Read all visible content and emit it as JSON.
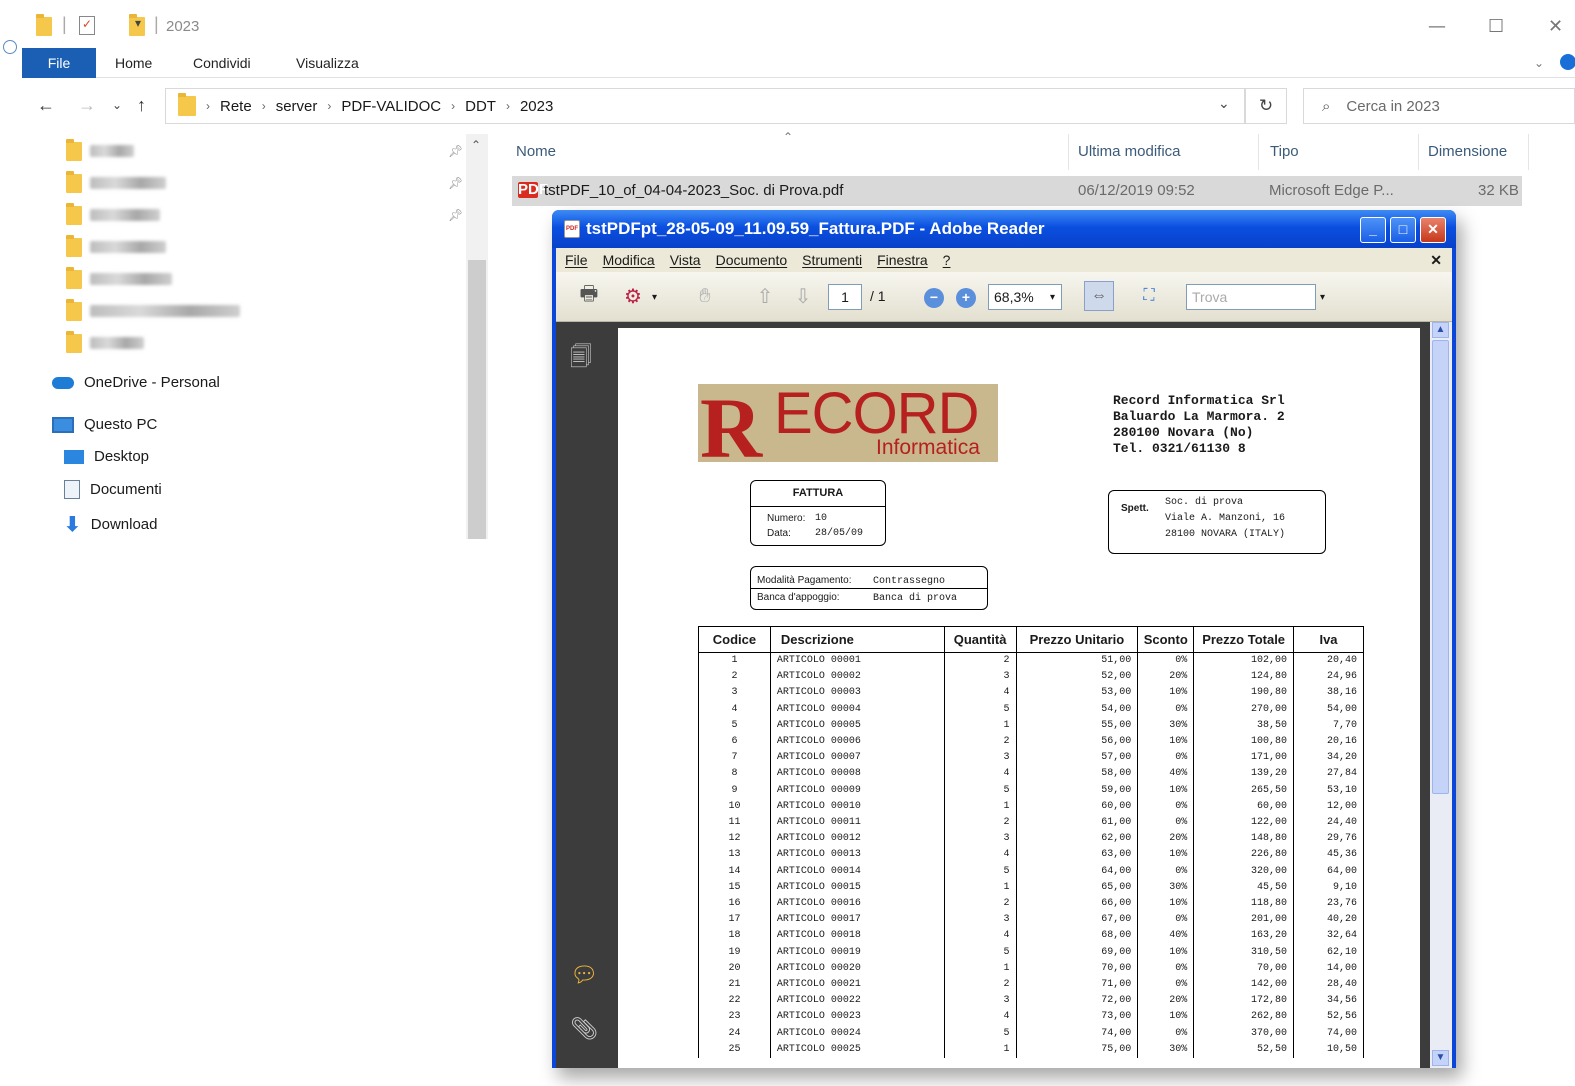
{
  "explorer": {
    "title": "2023",
    "ribbon_tabs": [
      "File",
      "Home",
      "Condividi",
      "Visualizza"
    ],
    "breadcrumb": [
      "Rete",
      "server",
      "PDF-VALIDOC",
      "DDT",
      "2023"
    ],
    "search_placeholder": "Cerca in 2023",
    "nav": {
      "onedrive": "OneDrive - Personal",
      "this_pc": "Questo PC",
      "desktop": "Desktop",
      "documents": "Documenti",
      "download": "Download"
    },
    "columns": {
      "name": "Nome",
      "modified": "Ultima modifica",
      "type": "Tipo",
      "size": "Dimensione"
    },
    "file": {
      "name": "tstPDF_10_of_04-04-2023_Soc. di Prova.pdf",
      "modified": "06/12/2019 09:52",
      "type": "Microsoft Edge P...",
      "size": "32 KB"
    }
  },
  "reader": {
    "title": "tstPDFpt_28-05-09_11.09.59_Fattura.PDF - Adobe Reader",
    "menu": [
      "File",
      "Modifica",
      "Vista",
      "Documento",
      "Strumenti",
      "Finestra",
      "?"
    ],
    "page_current": "1",
    "page_total": "/ 1",
    "zoom": "68,3%",
    "find_placeholder": "Trova"
  },
  "invoice": {
    "logo_letter": "R",
    "logo_word": "ECORD",
    "logo_sub": "Informatica",
    "company": [
      "Record Informatica Srl",
      "Baluardo La Marmora. 2",
      "280100 Novara (No)",
      "Tel. 0321/61130   8"
    ],
    "doc_type": "FATTURA",
    "numero_label": "Numero:",
    "numero": "10",
    "data_label": "Data:",
    "data": "28/05/09",
    "spett_label": "Spett.",
    "customer": [
      "Soc. di prova",
      "Viale A. Manzoni, 16",
      "28100 NOVARA (ITALY)"
    ],
    "pay_label": "Modalità Pagamento:",
    "pay": "Contrassegno",
    "bank_label": "Banca d'appoggio:",
    "bank": "Banca di prova",
    "headers": [
      "Codice",
      "Descrizione",
      "Quantità",
      "Prezzo Unitario",
      "Sconto",
      "Prezzo Totale",
      "Iva"
    ],
    "rows": [
      [
        "1",
        "ARTICOLO 00001",
        "2",
        "51,00",
        "0%",
        "102,00",
        "20,40"
      ],
      [
        "2",
        "ARTICOLO 00002",
        "3",
        "52,00",
        "20%",
        "124,80",
        "24,96"
      ],
      [
        "3",
        "ARTICOLO 00003",
        "4",
        "53,00",
        "10%",
        "190,80",
        "38,16"
      ],
      [
        "4",
        "ARTICOLO 00004",
        "5",
        "54,00",
        "0%",
        "270,00",
        "54,00"
      ],
      [
        "5",
        "ARTICOLO 00005",
        "1",
        "55,00",
        "30%",
        "38,50",
        "7,70"
      ],
      [
        "6",
        "ARTICOLO 00006",
        "2",
        "56,00",
        "10%",
        "100,80",
        "20,16"
      ],
      [
        "7",
        "ARTICOLO 00007",
        "3",
        "57,00",
        "0%",
        "171,00",
        "34,20"
      ],
      [
        "8",
        "ARTICOLO 00008",
        "4",
        "58,00",
        "40%",
        "139,20",
        "27,84"
      ],
      [
        "9",
        "ARTICOLO 00009",
        "5",
        "59,00",
        "10%",
        "265,50",
        "53,10"
      ],
      [
        "10",
        "ARTICOLO 00010",
        "1",
        "60,00",
        "0%",
        "60,00",
        "12,00"
      ],
      [
        "11",
        "ARTICOLO 00011",
        "2",
        "61,00",
        "0%",
        "122,00",
        "24,40"
      ],
      [
        "12",
        "ARTICOLO 00012",
        "3",
        "62,00",
        "20%",
        "148,80",
        "29,76"
      ],
      [
        "13",
        "ARTICOLO 00013",
        "4",
        "63,00",
        "10%",
        "226,80",
        "45,36"
      ],
      [
        "14",
        "ARTICOLO 00014",
        "5",
        "64,00",
        "0%",
        "320,00",
        "64,00"
      ],
      [
        "15",
        "ARTICOLO 00015",
        "1",
        "65,00",
        "30%",
        "45,50",
        "9,10"
      ],
      [
        "16",
        "ARTICOLO 00016",
        "2",
        "66,00",
        "10%",
        "118,80",
        "23,76"
      ],
      [
        "17",
        "ARTICOLO 00017",
        "3",
        "67,00",
        "0%",
        "201,00",
        "40,20"
      ],
      [
        "18",
        "ARTICOLO 00018",
        "4",
        "68,00",
        "40%",
        "163,20",
        "32,64"
      ],
      [
        "19",
        "ARTICOLO 00019",
        "5",
        "69,00",
        "10%",
        "310,50",
        "62,10"
      ],
      [
        "20",
        "ARTICOLO 00020",
        "1",
        "70,00",
        "0%",
        "70,00",
        "14,00"
      ],
      [
        "21",
        "ARTICOLO 00021",
        "2",
        "71,00",
        "0%",
        "142,00",
        "28,40"
      ],
      [
        "22",
        "ARTICOLO 00022",
        "3",
        "72,00",
        "20%",
        "172,80",
        "34,56"
      ],
      [
        "23",
        "ARTICOLO 00023",
        "4",
        "73,00",
        "10%",
        "262,80",
        "52,56"
      ],
      [
        "24",
        "ARTICOLO 00024",
        "5",
        "74,00",
        "0%",
        "370,00",
        "74,00"
      ],
      [
        "25",
        "ARTICOLO 00025",
        "1",
        "75,00",
        "30%",
        "52,50",
        "10,50"
      ]
    ]
  }
}
